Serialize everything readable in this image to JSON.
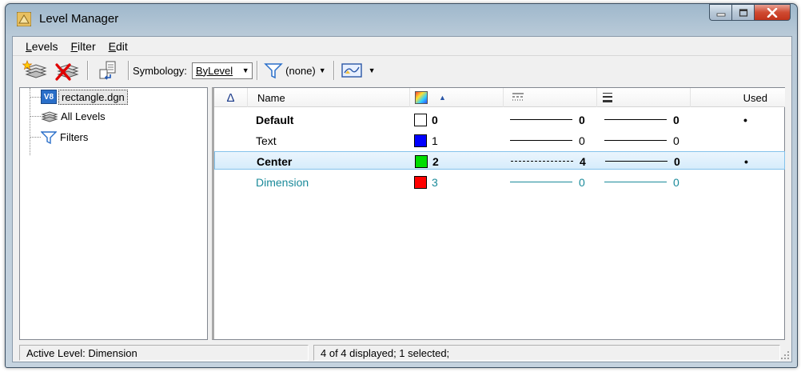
{
  "window": {
    "title": "Level Manager"
  },
  "menu": [
    {
      "mnemonic": "L",
      "rest": "evels"
    },
    {
      "mnemonic": "F",
      "rest": "ilter"
    },
    {
      "mnemonic": "E",
      "rest": "dit"
    }
  ],
  "toolbar": {
    "symbology_label": "Symbology:",
    "symbology_value": "ByLevel",
    "filter_value": "(none)"
  },
  "tree": {
    "root": "rectangle.dgn",
    "root_badge": "V8",
    "children": [
      "All Levels",
      "Filters"
    ]
  },
  "table": {
    "headers": {
      "sort": "Δ",
      "name": "Name",
      "used": "Used"
    },
    "rows": [
      {
        "name": "Default",
        "color_index": "0",
        "color": "#ffffff",
        "style": "0",
        "weight": "0",
        "used": "•",
        "bold": true,
        "selected": false,
        "teal": false
      },
      {
        "name": "Text",
        "color_index": "1",
        "color": "#0000ff",
        "style": "0",
        "weight": "0",
        "used": "",
        "bold": false,
        "selected": false,
        "teal": false
      },
      {
        "name": "Center",
        "color_index": "2",
        "color": "#00dd00",
        "style": "4",
        "weight": "0",
        "used": "•",
        "bold": true,
        "selected": true,
        "teal": false
      },
      {
        "name": "Dimension",
        "color_index": "3",
        "color": "#ff0000",
        "style": "0",
        "weight": "0",
        "used": "",
        "bold": false,
        "selected": false,
        "teal": true
      }
    ]
  },
  "status": {
    "active_level": "Active Level: Dimension",
    "display_info": "4 of 4 displayed; 1 selected;"
  },
  "colors": {
    "selection_border": "#84c2eb",
    "active_level_text": "#1a8a9a",
    "close_button": "#c1331b"
  }
}
